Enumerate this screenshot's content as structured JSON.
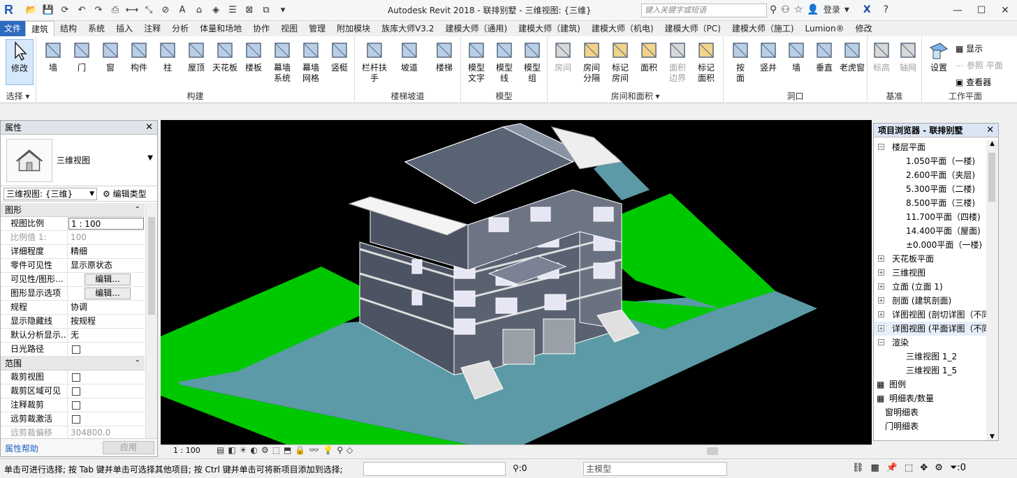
{
  "app": {
    "title": "Autodesk Revit 2018 -    联排别墅 - 三维视图: {三维}",
    "search_placeholder": "键入关键字或短语",
    "login": "登录",
    "colors": {
      "file_tab": "#2e6bbf",
      "grass": "#00c800",
      "road": "#5b9aa6",
      "roof": "#5a6374",
      "wall": "#4c5463"
    }
  },
  "tabs": [
    "文件",
    "建筑",
    "结构",
    "系统",
    "插入",
    "注释",
    "分析",
    "体量和场地",
    "协作",
    "视图",
    "管理",
    "附加模块",
    "族库大师V3.2",
    "建模大师（通用)",
    "建模大师（建筑)",
    "建模大师（机电)",
    "建模大师（PC)",
    "建模大师（施工)",
    "Lumion®",
    "修改"
  ],
  "ribbon": {
    "select": {
      "modify": "修改",
      "title": "选择 ▾"
    },
    "build": {
      "title": "构建",
      "buttons": [
        "墙",
        "门",
        "窗",
        "构件",
        "柱",
        "屋顶",
        "天花板",
        "楼板",
        "幕墙\n系统",
        "幕墙\n网格",
        "竖梃"
      ]
    },
    "stairs": {
      "title": "楼梯坡道",
      "buttons": [
        "栏杆扶手",
        "坡道",
        "楼梯"
      ]
    },
    "model": {
      "title": "模型",
      "buttons": [
        "模型\n文字",
        "模型\n线",
        "模型\n组"
      ]
    },
    "room": {
      "title": "房间和面积 ▾",
      "buttons": [
        "房间",
        "房间\n分隔",
        "标记\n房间",
        "面积",
        "面积\n边界",
        "标记\n面积"
      ]
    },
    "opening": {
      "title": "洞口",
      "buttons": [
        "按\n面",
        "竖井",
        "墙",
        "垂直",
        "老虎窗"
      ]
    },
    "datum": {
      "title": "基准",
      "buttons": [
        "标高",
        "轴网"
      ]
    },
    "workplane": {
      "title": "工作平面",
      "set": "设置",
      "show": "显示",
      "ref": "参照 平面",
      "viewer": "查看器"
    }
  },
  "properties": {
    "header": "属性",
    "type_name": "三维视图",
    "view_selector": "三维视图: {三维}",
    "edit_type": "编辑类型",
    "sections": [
      {
        "name": "图形",
        "rows": [
          {
            "k": "视图比例",
            "v": "1 : 100",
            "style": "input"
          },
          {
            "k": "比例值 1:",
            "v": "100",
            "style": "dim"
          },
          {
            "k": "详细程度",
            "v": "精细"
          },
          {
            "k": "零件可见性",
            "v": "显示原状态"
          },
          {
            "k": "可见性/图形...",
            "v": "编辑...",
            "style": "btn"
          },
          {
            "k": "图形显示选项",
            "v": "编辑...",
            "style": "btn"
          },
          {
            "k": "规程",
            "v": "协调"
          },
          {
            "k": "显示隐藏线",
            "v": "按规程"
          },
          {
            "k": "默认分析显示...",
            "v": "无"
          },
          {
            "k": "日光路径",
            "v": "",
            "style": "check"
          }
        ]
      },
      {
        "name": "范围",
        "rows": [
          {
            "k": "裁剪视图",
            "v": "",
            "style": "check"
          },
          {
            "k": "裁剪区域可见",
            "v": "",
            "style": "check"
          },
          {
            "k": "注释裁剪",
            "v": "",
            "style": "check"
          },
          {
            "k": "远剪裁激活",
            "v": "",
            "style": "check"
          },
          {
            "k": "远剪裁偏移",
            "v": "304800.0",
            "style": "dim"
          }
        ]
      }
    ],
    "help": "属性帮助",
    "apply": "应用"
  },
  "viewport": {
    "scale": "1 : 100"
  },
  "browser": {
    "header": "项目浏览器 - 联排别墅",
    "nodes": [
      {
        "label": "楼层平面",
        "level": 0,
        "toggle": "−"
      },
      {
        "label": "1.050平面（一楼)",
        "level": 2
      },
      {
        "label": "2.600平面（夹层)",
        "level": 2
      },
      {
        "label": "5.300平面（二楼)",
        "level": 2
      },
      {
        "label": "8.500平面（三楼)",
        "level": 2
      },
      {
        "label": "11.700平面（四楼)",
        "level": 2
      },
      {
        "label": "14.400平面（屋面)",
        "level": 2
      },
      {
        "label": "±0.000平面（一楼)",
        "level": 2
      },
      {
        "label": "天花板平面",
        "level": 0,
        "toggle": "+"
      },
      {
        "label": "三维视图",
        "level": 0,
        "toggle": "+"
      },
      {
        "label": "立面 (立面 1)",
        "level": 0,
        "toggle": "+"
      },
      {
        "label": "剖面 (建筑剖面)",
        "level": 0,
        "toggle": "+"
      },
      {
        "label": "详图视图 (剖切详图（不同",
        "level": 0,
        "toggle": "+"
      },
      {
        "label": "详图视图 (平面详图（不同",
        "level": 0,
        "toggle": "+",
        "sel": true
      },
      {
        "label": "渲染",
        "level": 0,
        "toggle": "−"
      },
      {
        "label": "三维视图 1_2",
        "level": 2
      },
      {
        "label": "三维视图 1_5",
        "level": 2
      },
      {
        "label": "图例",
        "level": 0,
        "icon": "▦"
      },
      {
        "label": "明细表/数量",
        "level": 0,
        "icon": "▦"
      },
      {
        "label": "窗明细表",
        "level": 1
      },
      {
        "label": "门明细表",
        "level": 1
      }
    ]
  },
  "status": {
    "message": "单击可进行选择; 按 Tab 键并单击可选择其他项目; 按 Ctrl 键并单击可将新项目添加到选择;",
    "select_count": ":0",
    "model": "主模型",
    "filter_count": ":0"
  }
}
